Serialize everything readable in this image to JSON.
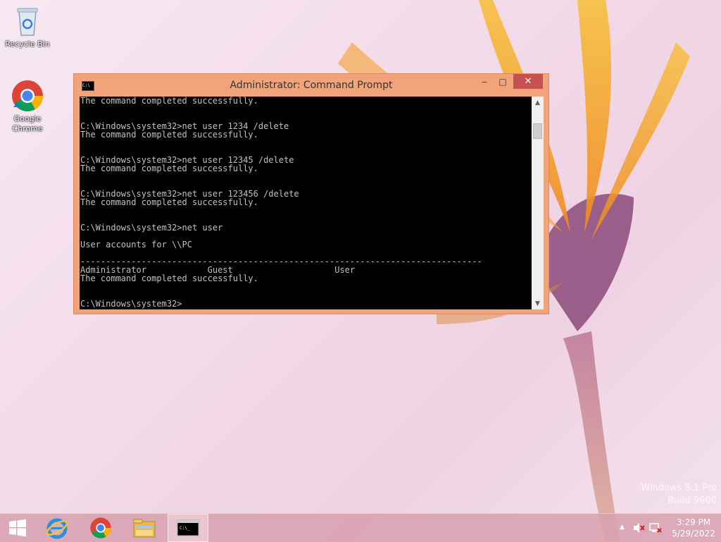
{
  "desktop": {
    "icons": [
      {
        "label": "Recycle Bin"
      },
      {
        "label": "Google Chrome"
      }
    ],
    "watermark": {
      "line1": "Windows 8.1 Pro",
      "line2": "Build 9600"
    }
  },
  "cmd_window": {
    "title": "Administrator: Command Prompt",
    "minimize": "‒",
    "maximize": "□",
    "close": "✕",
    "lines": [
      "The command completed successfully.",
      "",
      "",
      "C:\\Windows\\system32>net user 1234 /delete",
      "The command completed successfully.",
      "",
      "",
      "C:\\Windows\\system32>net user 12345 /delete",
      "The command completed successfully.",
      "",
      "",
      "C:\\Windows\\system32>net user 123456 /delete",
      "The command completed successfully.",
      "",
      "",
      "C:\\Windows\\system32>net user",
      "",
      "User accounts for \\\\PC",
      "",
      "-------------------------------------------------------------------------------",
      "Administrator            Guest                    User",
      "The command completed successfully.",
      "",
      "",
      "C:\\Windows\\system32>"
    ]
  },
  "taskbar": {
    "items": [
      "start-button",
      "internet-explorer",
      "google-chrome",
      "file-explorer",
      "command-prompt"
    ],
    "clock": {
      "time": "3:29 PM",
      "date": "5/29/2022"
    }
  },
  "colors": {
    "window_frame": "#f1a47a",
    "close_button": "#c75050",
    "console_bg": "#000000",
    "console_fg": "#c0c0c0"
  }
}
